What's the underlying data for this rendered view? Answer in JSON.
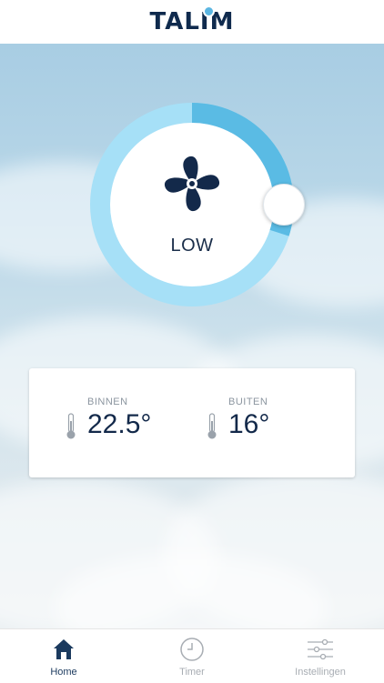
{
  "header": {
    "logo_text": "TALIM"
  },
  "dial": {
    "mode": "LOW",
    "level": 0.3,
    "track_color": "#a6e0f7",
    "fill_color": "#5abbe4"
  },
  "temperatures": {
    "inside": {
      "label": "BINNEN",
      "value": "22.5°"
    },
    "outside": {
      "label": "BUITEN",
      "value": "16°"
    }
  },
  "tabs": [
    {
      "label": "Home",
      "icon": "home-icon",
      "active": true
    },
    {
      "label": "Timer",
      "icon": "clock-icon",
      "active": false
    },
    {
      "label": "Instellingen",
      "icon": "sliders-icon",
      "active": false
    }
  ],
  "colors": {
    "accent": "#1b3a5e",
    "inactive": "#a8adb3"
  }
}
